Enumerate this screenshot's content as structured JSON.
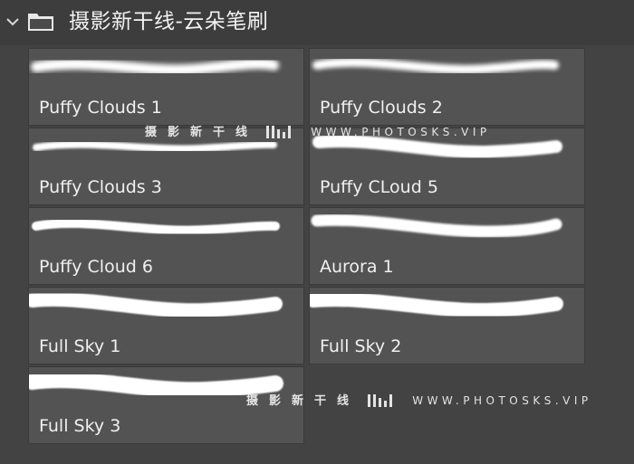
{
  "group": {
    "title": "摄影新干线-云朵笔刷",
    "expanded": true
  },
  "brushes": [
    {
      "name": "Puffy Clouds 1"
    },
    {
      "name": "Puffy Clouds 2"
    },
    {
      "name": "Puffy Clouds 3"
    },
    {
      "name": "Puffy CLoud 5"
    },
    {
      "name": "Puffy Cloud 6"
    },
    {
      "name": "Aurora 1"
    },
    {
      "name": "Full Sky 1"
    },
    {
      "name": "Full Sky 2"
    },
    {
      "name": "Full Sky 3"
    }
  ],
  "watermark": {
    "cn": "摄影新干线",
    "url": "WWW.PHOTOSKS.VIP"
  },
  "colors": {
    "panel_bg": "#434343",
    "tile_bg": "#535353",
    "text": "#f0f0f0",
    "stroke": "#ffffff"
  }
}
